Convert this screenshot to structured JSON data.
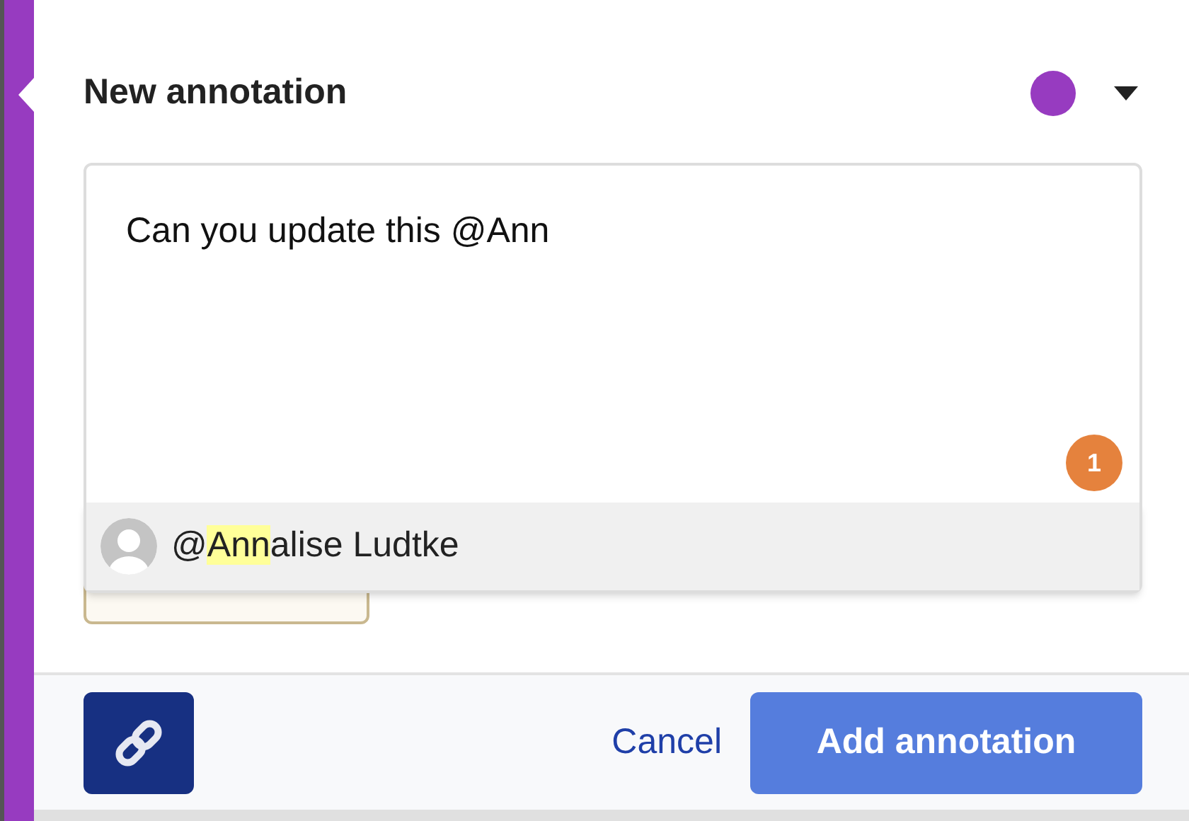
{
  "panel": {
    "title": "New annotation",
    "color": "#973bc0"
  },
  "comment": {
    "value": "Can you update this @Ann",
    "badge": "1"
  },
  "suggestions": [
    {
      "prefix": "@",
      "match": "Ann",
      "rest": "alise Ludtke",
      "selected": true
    }
  ],
  "footer": {
    "cancel": "Cancel",
    "submit": "Add annotation"
  }
}
